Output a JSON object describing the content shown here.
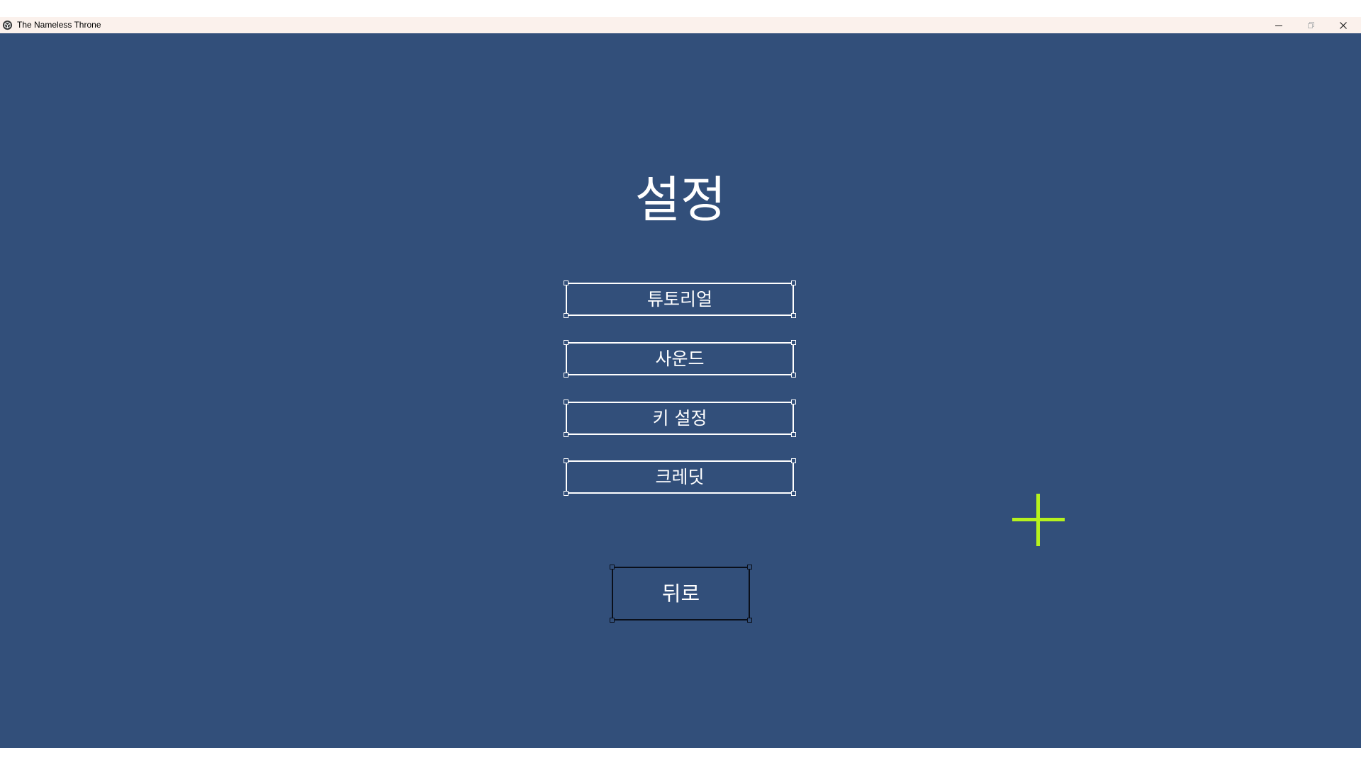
{
  "window": {
    "title": "The Nameless Throne",
    "icon": "unity-cube-icon",
    "controls": [
      "minimize-icon",
      "maximize-icon",
      "close-icon"
    ]
  },
  "menu": {
    "title": "설정",
    "buttons": [
      {
        "label": "튜토리얼"
      },
      {
        "label": "사운드"
      },
      {
        "label": "키 설정"
      },
      {
        "label": "크레딧"
      }
    ],
    "back_label": "뒤로"
  },
  "cursor": {
    "icon": "crosshair-icon",
    "color": "#b6f21d"
  },
  "colors": {
    "background": "#324f7a",
    "titlebar": "#fbf1ec",
    "text": "#ffffff"
  }
}
